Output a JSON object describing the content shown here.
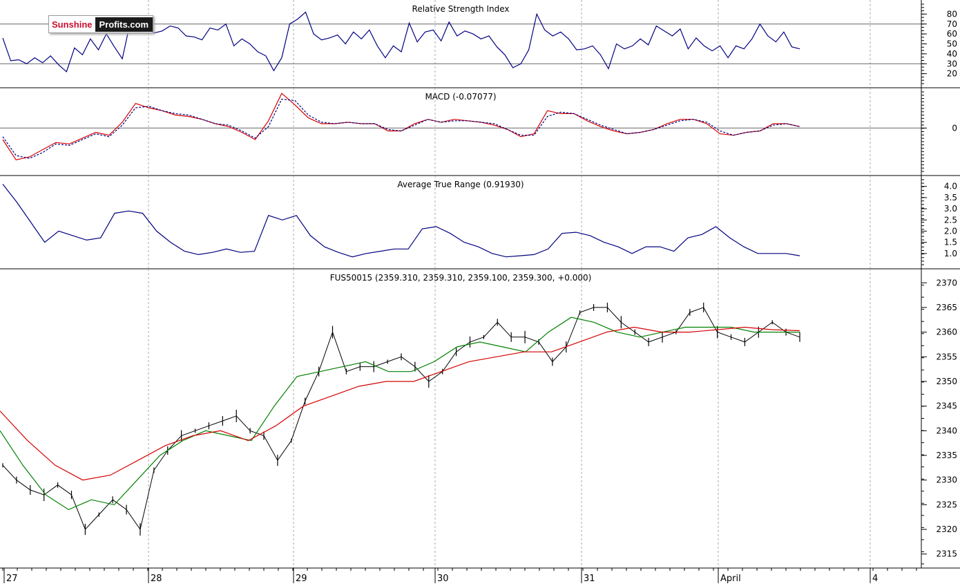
{
  "logo": {
    "part1": "Sunshine",
    "part2": "Profits.com",
    "color1": "#c8102e",
    "bg2": "#1a1a1a"
  },
  "colors": {
    "price": "#000000",
    "ma_fast": "#008000",
    "ma_slow": "#d40000",
    "indicator": "#000080",
    "grid": "#aaaaaa",
    "frame": "#000000"
  },
  "chart_data": [
    {
      "type": "line",
      "title": "Relative Strength Index",
      "ylim": [
        10,
        90
      ],
      "y_ticks": [
        20,
        30,
        40,
        50,
        60,
        70,
        80
      ],
      "reference_lines": [
        30,
        70
      ],
      "series": [
        {
          "values": [
            56,
            33,
            34,
            30,
            36,
            31,
            38,
            29,
            22,
            46,
            39,
            55,
            44,
            60,
            47,
            35,
            72,
            65,
            70,
            61,
            63,
            68,
            66,
            58,
            57,
            54,
            66,
            64,
            70,
            48,
            55,
            50,
            42,
            38,
            23,
            36,
            70,
            75,
            82,
            60,
            54,
            56,
            59,
            50,
            62,
            55,
            64,
            48,
            36,
            48,
            42,
            71,
            52,
            62,
            64,
            53,
            72,
            58,
            63,
            60,
            55,
            58,
            47,
            39,
            26,
            30,
            44,
            80,
            64,
            58,
            62,
            55,
            44,
            45,
            48,
            39,
            25,
            50,
            45,
            48,
            55,
            49,
            68,
            63,
            58,
            65,
            45,
            56,
            48,
            43,
            48,
            36,
            48,
            45,
            55,
            70,
            58,
            52,
            62,
            47,
            45
          ]
        }
      ]
    },
    {
      "type": "line",
      "title": "MACD (-0.07077)",
      "ylim": [
        -3.0,
        2.5
      ],
      "y_ticks": [
        0
      ],
      "reference_lines": [
        0
      ],
      "series": [
        {
          "values": [
            -0.8,
            -2.2,
            -2.0,
            -1.5,
            -1.0,
            -1.1,
            -0.7,
            -0.3,
            -0.5,
            0.4,
            1.7,
            1.4,
            1.2,
            0.9,
            0.8,
            0.6,
            0.3,
            0.1,
            -0.3,
            -0.8,
            0.5,
            2.4,
            1.6,
            0.7,
            0.3,
            0.3,
            0.4,
            0.3,
            0.3,
            -0.2,
            -0.2,
            0.3,
            0.6,
            0.4,
            0.6,
            0.5,
            0.4,
            0.2,
            -0.1,
            -0.6,
            -0.4,
            1.2,
            1.0,
            1.0,
            0.5,
            0.1,
            -0.2,
            -0.4,
            -0.3,
            -0.1,
            0.3,
            0.6,
            0.6,
            0.3,
            -0.4,
            -0.5,
            -0.3,
            -0.2,
            0.3,
            0.3,
            0.1
          ]
        },
        {
          "values": [
            -0.6,
            -1.9,
            -2.1,
            -1.7,
            -1.1,
            -1.2,
            -0.8,
            -0.4,
            -0.6,
            0.2,
            1.4,
            1.5,
            1.2,
            1.0,
            0.9,
            0.6,
            0.3,
            0.2,
            -0.2,
            -0.7,
            0.1,
            2.0,
            1.9,
            0.9,
            0.4,
            0.3,
            0.4,
            0.3,
            0.3,
            -0.1,
            -0.2,
            0.2,
            0.6,
            0.4,
            0.5,
            0.5,
            0.4,
            0.3,
            -0.1,
            -0.5,
            -0.5,
            0.8,
            1.1,
            1.0,
            0.6,
            0.2,
            -0.1,
            -0.4,
            -0.3,
            -0.1,
            0.2,
            0.5,
            0.6,
            0.4,
            -0.2,
            -0.5,
            -0.3,
            -0.2,
            0.2,
            0.3,
            0.1
          ]
        }
      ]
    },
    {
      "type": "line",
      "title": "Average True Range (0.91930)",
      "ylim": [
        0.5,
        4.3
      ],
      "y_ticks": [
        1.0,
        1.5,
        2.0,
        2.5,
        3.0,
        3.5,
        4.0
      ],
      "series": [
        {
          "values": [
            4.1,
            3.3,
            2.4,
            1.5,
            2.0,
            1.8,
            1.6,
            1.7,
            2.8,
            2.9,
            2.8,
            2.0,
            1.5,
            1.1,
            0.95,
            1.05,
            1.2,
            1.05,
            1.1,
            2.7,
            2.5,
            2.7,
            1.8,
            1.3,
            1.05,
            0.85,
            1.0,
            1.1,
            1.2,
            1.2,
            2.1,
            2.2,
            1.9,
            1.5,
            1.3,
            1.0,
            0.85,
            0.9,
            0.95,
            1.2,
            1.9,
            1.95,
            1.8,
            1.5,
            1.3,
            1.0,
            1.3,
            1.3,
            1.1,
            1.7,
            1.85,
            2.2,
            1.7,
            1.3,
            1.0,
            1.0,
            1.0,
            0.9
          ]
        }
      ]
    },
    {
      "type": "bar",
      "title": "FUS50015 (2359.310, 2359.310, 2359.100, 2359.300, +0.000)",
      "ylim": [
        2313,
        2372
      ],
      "y_ticks": [
        2315,
        2320,
        2325,
        2330,
        2335,
        2340,
        2345,
        2350,
        2355,
        2360,
        2365,
        2370
      ],
      "x_labels": [
        "27",
        "28",
        "29",
        "30",
        "31",
        "April",
        "4"
      ],
      "series": [
        {
          "name": "price",
          "values": [
            2333,
            2330,
            2328,
            2327,
            2329,
            2327,
            2320,
            2323,
            2326,
            2324,
            2320,
            2332,
            2336,
            2339,
            2340,
            2341,
            2342,
            2343,
            2340,
            2339,
            2334,
            2338,
            2346,
            2352,
            2360,
            2352,
            2353,
            2353,
            2354,
            2355,
            2353,
            2350,
            2352,
            2356,
            2358,
            2359,
            2362,
            2359,
            2359,
            2358,
            2354,
            2357,
            2364,
            2365,
            2365,
            2362,
            2360,
            2358,
            2359,
            2360,
            2364,
            2365,
            2360,
            2359,
            2358,
            2360,
            2362,
            2360,
            2359
          ]
        },
        {
          "name": "MA fast",
          "values": [
            2340,
            2333,
            2327,
            2324,
            2326,
            2325,
            2330,
            2335,
            2338,
            2340,
            2339,
            2338,
            2345,
            2351,
            2352,
            2353,
            2354,
            2352,
            2352,
            2354,
            2357,
            2358,
            2357,
            2356,
            2360,
            2363,
            2362,
            2360,
            2359,
            2360,
            2361,
            2361,
            2361,
            2360,
            2360,
            2360
          ]
        },
        {
          "name": "MA slow",
          "values": [
            2344,
            2338,
            2333,
            2330,
            2331,
            2334,
            2337,
            2339,
            2340,
            2338,
            2341,
            2345,
            2347,
            2349,
            2350,
            2350,
            2352,
            2354,
            2355,
            2356,
            2356,
            2358,
            2360,
            2361,
            2360,
            2360,
            2360.5,
            2361,
            2360.5,
            2360.3
          ]
        }
      ]
    }
  ]
}
